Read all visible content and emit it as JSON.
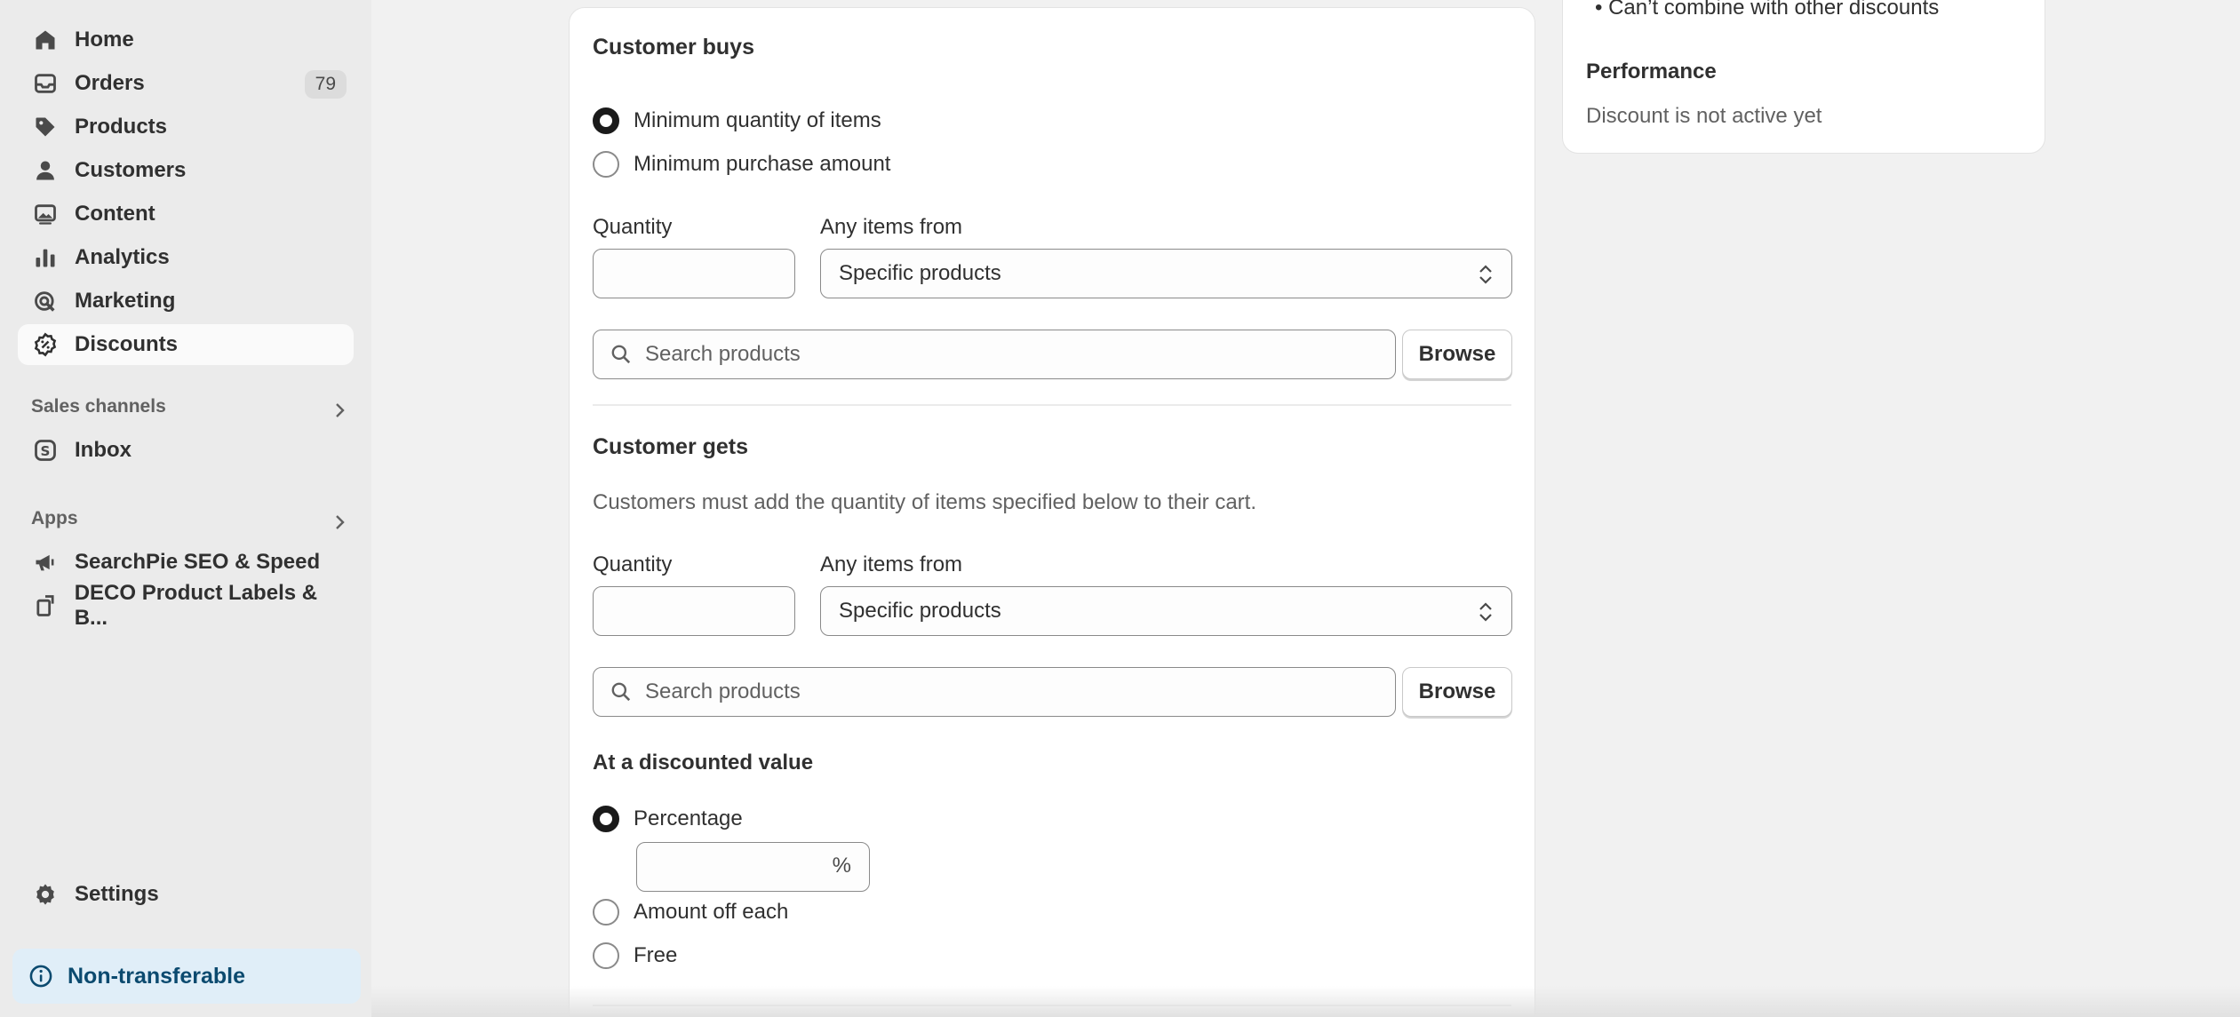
{
  "sidebar": {
    "nav": [
      {
        "label": "Home",
        "icon": "home-icon"
      },
      {
        "label": "Orders",
        "icon": "inbox-tray-icon",
        "badge": "79"
      },
      {
        "label": "Products",
        "icon": "tag-icon"
      },
      {
        "label": "Customers",
        "icon": "person-icon"
      },
      {
        "label": "Content",
        "icon": "image-icon"
      },
      {
        "label": "Analytics",
        "icon": "bar-chart-icon"
      },
      {
        "label": "Marketing",
        "icon": "target-icon"
      },
      {
        "label": "Discounts",
        "icon": "discount-badge-icon",
        "active": true
      }
    ],
    "sales_channels_label": "Sales channels",
    "inbox_label": "Inbox",
    "apps_label": "Apps",
    "apps": [
      {
        "label": "SearchPie SEO & Speed",
        "icon": "megaphone-icon"
      },
      {
        "label": "DECO Product Labels & B...",
        "icon": "label-icon"
      }
    ],
    "settings_label": "Settings",
    "nontransferable_label": "Non-transferable"
  },
  "customer_buys": {
    "heading": "Customer buys",
    "options": [
      "Minimum quantity of items",
      "Minimum purchase amount"
    ],
    "selected": "Minimum quantity of items",
    "quantity_label": "Quantity",
    "quantity_value": "",
    "items_from_label": "Any items from",
    "items_from_value": "Specific products",
    "search_placeholder": "Search products",
    "browse_label": "Browse"
  },
  "customer_gets": {
    "heading": "Customer gets",
    "helper": "Customers must add the quantity of items specified below to their cart.",
    "quantity_label": "Quantity",
    "quantity_value": "",
    "items_from_label": "Any items from",
    "items_from_value": "Specific products",
    "search_placeholder": "Search products",
    "browse_label": "Browse"
  },
  "discounted_value": {
    "heading": "At a discounted value",
    "options": [
      "Percentage",
      "Amount off each",
      "Free"
    ],
    "selected": "Percentage",
    "percent_suffix": "%",
    "percent_value": ""
  },
  "summary": {
    "bullet": "Can’t combine with other discounts",
    "performance_heading": "Performance",
    "performance_text": "Discount is not active yet"
  },
  "colors": {
    "sidebar_bg": "#ebebeb",
    "page_bg": "#f1f1f1",
    "card_bg": "#ffffff",
    "nontransferable_bg": "#e0eef8",
    "nontransferable_text": "#0b4a6f"
  }
}
